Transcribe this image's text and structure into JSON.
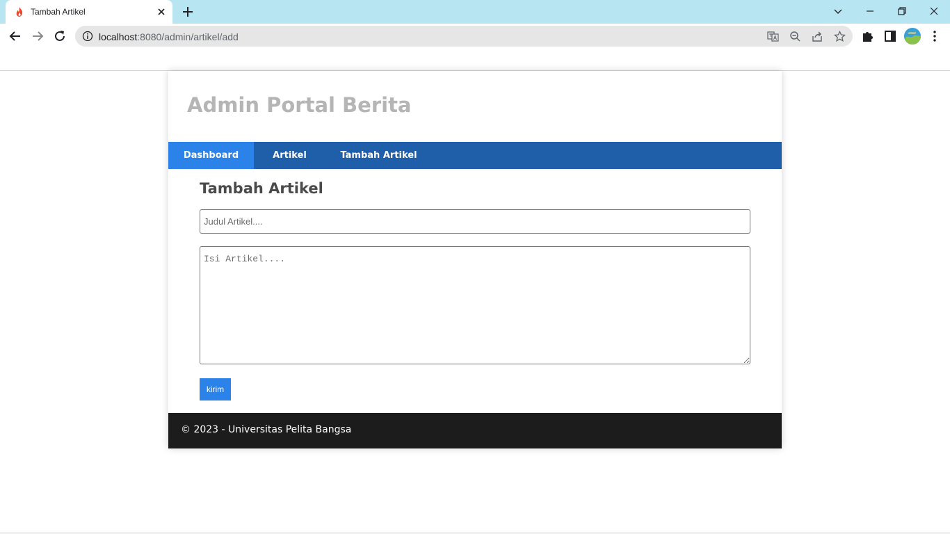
{
  "browser": {
    "tab_title": "Tambah Artikel",
    "url_host": "localhost",
    "url_path": ":8080/admin/artikel/add"
  },
  "site": {
    "title": "Admin Portal Berita"
  },
  "nav": {
    "items": [
      {
        "label": "Dashboard"
      },
      {
        "label": "Artikel"
      },
      {
        "label": "Tambah Artikel"
      }
    ],
    "active": "Dashboard",
    "bar_color": "#1f5faa",
    "active_color": "#2b83ea"
  },
  "form": {
    "heading": "Tambah Artikel",
    "title_placeholder": "Judul Artikel....",
    "title_value": "",
    "body_placeholder": "Isi Artikel....",
    "body_value": "",
    "submit_label": "kirim"
  },
  "footer": {
    "text": "© 2023 - Universitas Pelita Bangsa"
  },
  "icons": {
    "tab_favicon": "flame-icon",
    "tab_close": "close-icon",
    "new_tab": "plus-icon",
    "back": "arrow-left-icon",
    "forward": "arrow-right-icon",
    "reload": "reload-icon",
    "site_info": "info-icon",
    "translate": "translate-icon",
    "zoom": "zoom-out-icon",
    "share": "share-icon",
    "bookmark": "star-icon",
    "extensions": "puzzle-icon",
    "side_panel": "side-panel-icon",
    "menu": "kebab-menu-icon"
  }
}
